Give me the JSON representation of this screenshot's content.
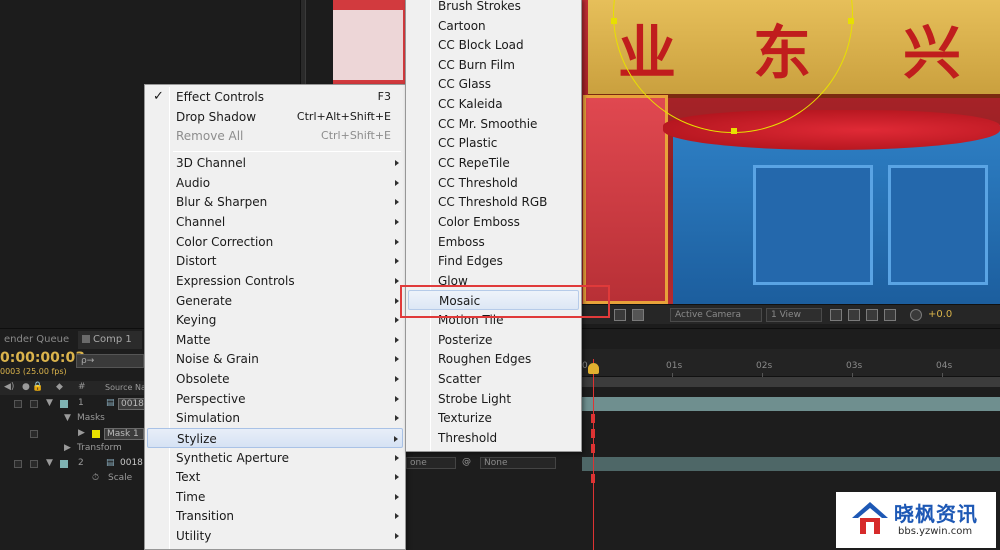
{
  "context_menu": {
    "items": [
      {
        "label": "Effect Controls",
        "shortcut": "F3",
        "checked": true
      },
      {
        "label": "Drop Shadow",
        "shortcut": "Ctrl+Alt+Shift+E"
      },
      {
        "label": "Remove All",
        "shortcut": "Ctrl+Shift+E",
        "disabled": true
      },
      {
        "label": "3D Channel"
      },
      {
        "label": "Audio"
      },
      {
        "label": "Blur & Sharpen"
      },
      {
        "label": "Channel"
      },
      {
        "label": "Color Correction"
      },
      {
        "label": "Distort"
      },
      {
        "label": "Expression Controls"
      },
      {
        "label": "Generate"
      },
      {
        "label": "Keying"
      },
      {
        "label": "Matte"
      },
      {
        "label": "Noise & Grain"
      },
      {
        "label": "Obsolete"
      },
      {
        "label": "Perspective"
      },
      {
        "label": "Simulation"
      },
      {
        "label": "Stylize",
        "highlighted": true
      },
      {
        "label": "Synthetic Aperture"
      },
      {
        "label": "Text"
      },
      {
        "label": "Time"
      },
      {
        "label": "Transition"
      },
      {
        "label": "Utility"
      }
    ]
  },
  "submenu": {
    "items": [
      "Brush Strokes",
      "Cartoon",
      "CC Block Load",
      "CC Burn Film",
      "CC Glass",
      "CC Kaleida",
      "CC Mr. Smoothie",
      "CC Plastic",
      "CC RepeTile",
      "CC Threshold",
      "CC Threshold RGB",
      "Color Emboss",
      "Emboss",
      "Find Edges",
      "Glow",
      "Mosaic",
      "Motion Tile",
      "Posterize",
      "Roughen Edges",
      "Scatter",
      "Strobe Light",
      "Texturize",
      "Threshold"
    ],
    "highlighted": "Mosaic"
  },
  "viewer_toolbar": {
    "camera": "Active Camera",
    "views": "1 View",
    "exposure": "+0.0"
  },
  "timeline": {
    "tabs": [
      "ender Queue",
      "Comp 1"
    ],
    "timecode": "0:00:00:03",
    "fps": "0003 (25.00 fps)",
    "search_placeholder": "ρ→",
    "col_number": "#",
    "col_source": "Source Na",
    "layer1": {
      "num": "1",
      "name": "0018"
    },
    "masks_label": "Masks",
    "mask1_label": "Mask 1",
    "transform_label": "Transform",
    "layer2": {
      "num": "2",
      "name": "0018"
    },
    "scale_label": "Scale",
    "mode1": "one",
    "mode2": "None",
    "ruler_labels": [
      "0",
      "01s",
      "02s",
      "03s",
      "04s"
    ]
  },
  "signboard_chars": [
    "业",
    "东",
    "兴"
  ],
  "watermark": {
    "text": "晓枫资讯",
    "url": "bbs.yzwin.com"
  },
  "colors": {
    "accent_timecode": "#dbb44c",
    "highlight_box": "#e03a3a",
    "mask_handle": "#e8e000"
  }
}
